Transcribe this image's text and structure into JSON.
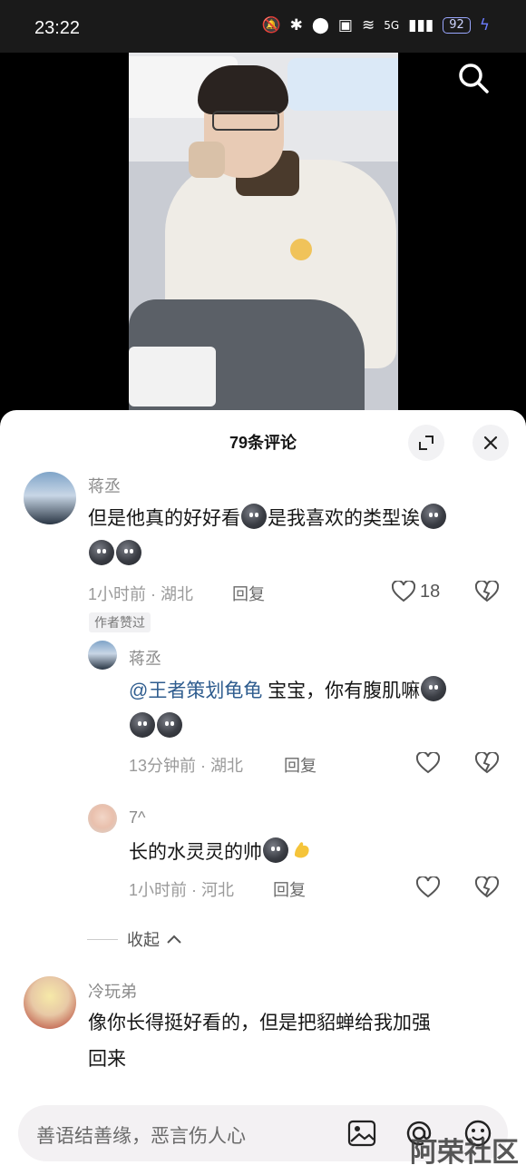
{
  "status_bar": {
    "time": "23:22",
    "network": "5G",
    "battery": "92"
  },
  "sheet": {
    "title": "79条评论"
  },
  "comments": [
    {
      "user": "蒋丞",
      "text": "但是他真的好好看",
      "text2": "是我喜欢的类型诶",
      "time_location": "1小时前 · 湖北",
      "reply_label": "回复",
      "likes": "18",
      "author_badge": "作者赞过"
    },
    {
      "user": "蒋丞",
      "mention": "@王者策划龟龟",
      "text": "宝宝，你有腹肌嘛",
      "time_location": "13分钟前 · 湖北",
      "reply_label": "回复"
    },
    {
      "user": "7^",
      "text": "长的水灵灵的帅",
      "time_location": "1小时前 · 河北",
      "reply_label": "回复"
    },
    {
      "user": "冷玩弟",
      "text_line1": "像你长得挺好看的，但是把貂蝉给我加强",
      "text_line2": "回来"
    }
  ],
  "collapse_label": "收起",
  "input": {
    "placeholder": "善语结善缘，恶言伤人心"
  },
  "watermark": "阿荣社区",
  "colors": {
    "mention": "#2f5d8f",
    "sheet_bg": "#ffffff"
  }
}
